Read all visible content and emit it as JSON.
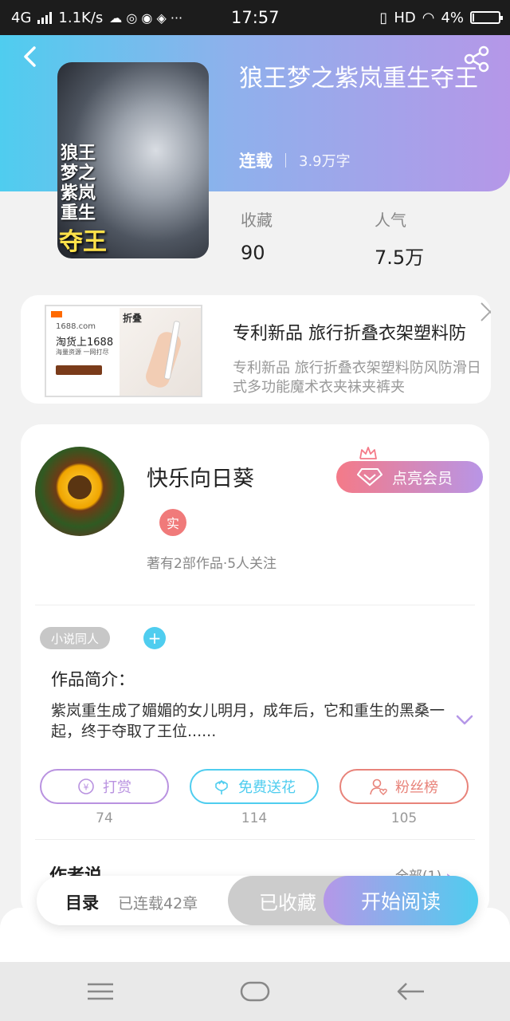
{
  "status_bar": {
    "network": "4G",
    "speed": "1.1K/s",
    "time": "17:57",
    "hd": "HD",
    "battery": "4%",
    "battery_level": 0.04
  },
  "header": {
    "back_icon": "chevron-left-icon",
    "share_icon": "share-icon"
  },
  "book": {
    "title": "狼王梦之紫岚重生夺王",
    "cover_text_main": "狼王梦之紫岚重生",
    "cover_text_highlight": "夺王",
    "status": "连载",
    "word_count": "3.9万字",
    "favorites_label": "收藏",
    "favorites_value": "90",
    "popularity_label": "人气",
    "popularity_value": "7.5万"
  },
  "ad": {
    "image_site": "1688.com",
    "image_headline": "淘货上1688",
    "image_sub": "海量资源 一网打尽",
    "image_product": "折叠",
    "title": "专利新品 旅行折叠衣架塑料防",
    "description": "专利新品 旅行折叠衣架塑料防风防滑日式多功能魔术衣夹袜夹裤夹",
    "close_icon": "close-icon"
  },
  "author": {
    "name": "快乐向日葵",
    "verified_badge": "实",
    "info": "著有2部作品·5人关注",
    "vip_button": "点亮会员"
  },
  "tags": {
    "items": [
      "小说同人"
    ],
    "add": "+"
  },
  "intro": {
    "heading": "作品简介：",
    "text": "紫岚重生成了媚媚的女儿明月，成年后，它和重生的黑桑一起，终于夺取了王位......"
  },
  "actions": [
    {
      "label": "打赏",
      "count": "74",
      "color": "#b992e0",
      "icon": "yen-coin-icon"
    },
    {
      "label": "免费送花",
      "count": "114",
      "color": "#4fcdef",
      "icon": "flower-icon"
    },
    {
      "label": "粉丝榜",
      "count": "105",
      "color": "#e8837a",
      "icon": "user-heart-icon"
    }
  ],
  "author_says": {
    "heading": "作者说",
    "all_link": "全部(1)"
  },
  "bottom_bar": {
    "catalog": "目录",
    "chapters": "已连载42章",
    "favorited": "已收藏",
    "read": "开始阅读"
  },
  "colors": {
    "accent_blue": "#4fcdef",
    "accent_purple": "#b597e8",
    "accent_pink": "#f47a88"
  }
}
